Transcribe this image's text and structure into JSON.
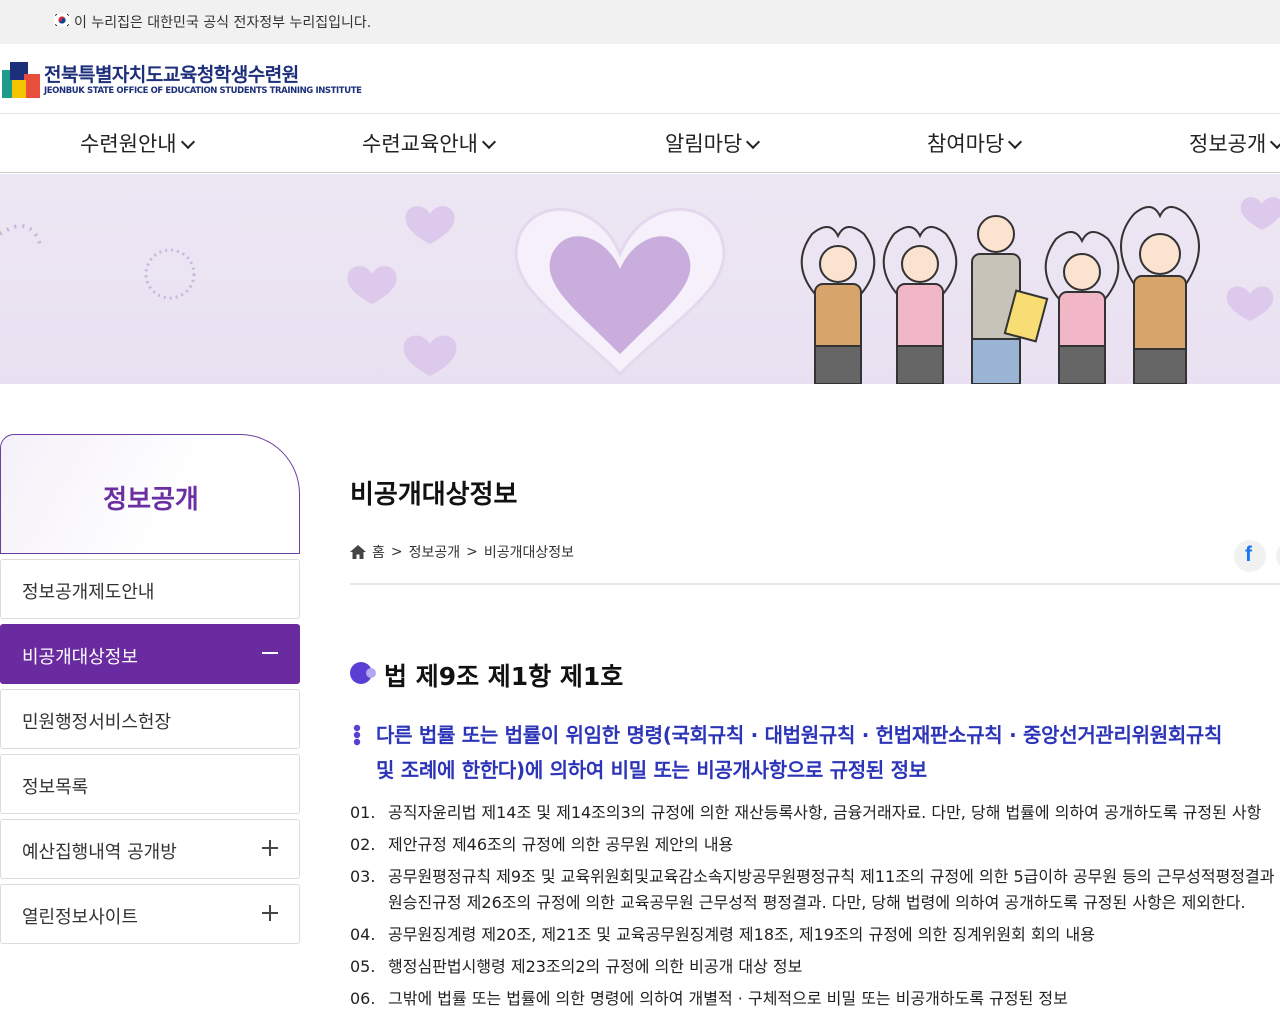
{
  "gov_banner": {
    "text": "이 누리집은 대한민국 공식 전자정부 누리집입니다."
  },
  "header": {
    "logo_kor": "전북특별자치도교육청학생수련원",
    "logo_eng": "JEONBUK STATE OFFICE OF EDUCATION STUDENTS TRAINING INSTITUTE"
  },
  "gnb": [
    "수련원안내",
    "수련교육안내",
    "알림마당",
    "참여마당",
    "정보공개"
  ],
  "sidebar": {
    "title": "정보공개",
    "items": [
      {
        "label": "정보공개제도안내",
        "sign": ""
      },
      {
        "label": "비공개대상정보",
        "sign": "minus"
      },
      {
        "label": "민원행정서비스헌장",
        "sign": ""
      },
      {
        "label": "정보목록",
        "sign": ""
      },
      {
        "label": "예산집행내역 공개방",
        "sign": "plus"
      },
      {
        "label": "열린정보사이트",
        "sign": "plus"
      }
    ]
  },
  "content": {
    "page_title": "비공개대상정보",
    "breadcrumb": {
      "home": "홈",
      "sep": ">",
      "level1": "정보공개",
      "level2": "비공개대상정보"
    },
    "share": {
      "facebook": "f"
    },
    "section_title": "법 제9조 제1항 제1호",
    "subtitle_lines": [
      "다른 법률 또는 법률이 위임한 명령(국회규칙 · 대법원규칙 · 헌법재판소규칙 · 중앙선거관리위원회규칙",
      "및 조례에 한한다)에 의하여 비밀 또는 비공개사항으로 규정된 정보"
    ],
    "list": [
      {
        "num": "01.",
        "lines": [
          "공직자윤리법 제14조 및 제14조의3의 규정에 의한 재산등록사항, 금융거래자료. 다만, 당해 법률에 의하여 공개하도록 규정된 사항"
        ]
      },
      {
        "num": "02.",
        "lines": [
          "제안규정 제46조의 규정에 의한 공무원 제안의 내용"
        ]
      },
      {
        "num": "03.",
        "lines": [
          "공무원평정규칙 제9조 및 교육위원회및교육감소속지방공무원평정규칙 제11조의 규정에 의한 5급이하 공무원 등의 근무성적평정결과",
          "원승진규정 제26조의 규정에 의한 교육공무원 근무성적 평정결과. 다만, 당해 법령에 의하여 공개하도록 규정된 사항은 제외한다."
        ]
      },
      {
        "num": "04.",
        "lines": [
          "공무원징계령 제20조, 제21조 및 교육공무원징계령 제18조, 제19조의 규정에 의한 징계위원회 회의 내용"
        ]
      },
      {
        "num": "05.",
        "lines": [
          "행정심판법시행령 제23조의2의 규정에 의한 비공개 대상 정보"
        ]
      },
      {
        "num": "06.",
        "lines": [
          "그밖에 법률 또는 법률에 의한 명령에 의하여 개별적 · 구체적으로 비밀 또는 비공개하도록 규정된 정보"
        ]
      }
    ]
  },
  "colors": {
    "accent_purple": "#6a2ba1",
    "subtitle_blue": "#2c34b8",
    "hero_bg": "#ede6f3"
  }
}
